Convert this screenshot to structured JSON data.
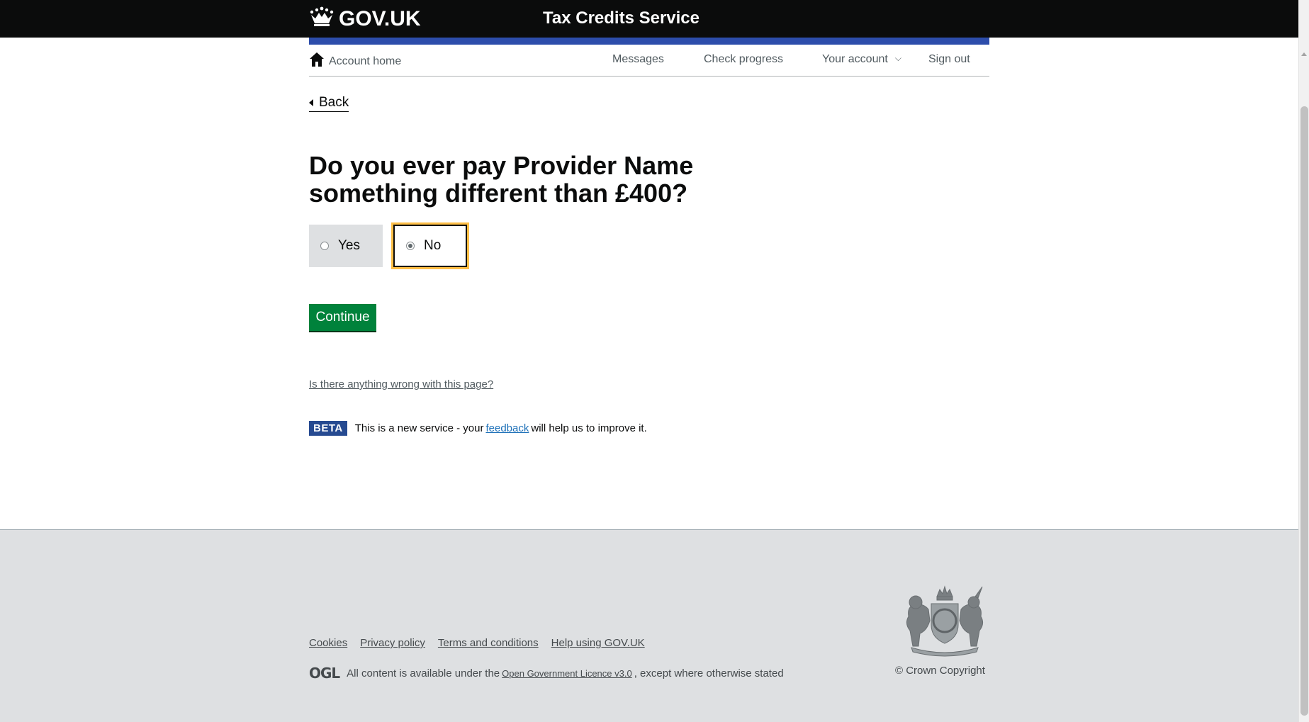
{
  "header": {
    "logo_text": "GOV.UK",
    "service_name": "Tax Credits Service"
  },
  "nav": {
    "home_label": "Account home",
    "items": [
      {
        "label": "Messages"
      },
      {
        "label": "Check progress"
      },
      {
        "label": "Your account"
      },
      {
        "label": "Sign out"
      }
    ]
  },
  "back_label": "Back",
  "question": {
    "title": "Do you ever pay Provider Name something different than £400?",
    "options": [
      {
        "label": "Yes",
        "selected": false
      },
      {
        "label": "No",
        "selected": true
      }
    ]
  },
  "continue_label": "Continue",
  "report_link": "Is there anything wrong with this page?",
  "beta": {
    "tag": "BETA",
    "text_before": "This is a new service  - your",
    "link": "feedback",
    "text_after": "will help us to improve it."
  },
  "footer": {
    "links": [
      "Cookies",
      "Privacy policy",
      "Terms and conditions",
      "Help using GOV.UK"
    ],
    "ogl_logo": "OGL",
    "licence_before": "All content is available under the",
    "licence_link": "Open Government Licence v3.0",
    "licence_after": ", except where otherwise stated",
    "copyright": "© Crown Copyright"
  },
  "colors": {
    "header_bg": "#0b0c0c",
    "accent_blue": "#2d4dab",
    "button_green": "#00823b",
    "focus_yellow": "#ffbf47",
    "footer_bg": "#dee0e2"
  }
}
